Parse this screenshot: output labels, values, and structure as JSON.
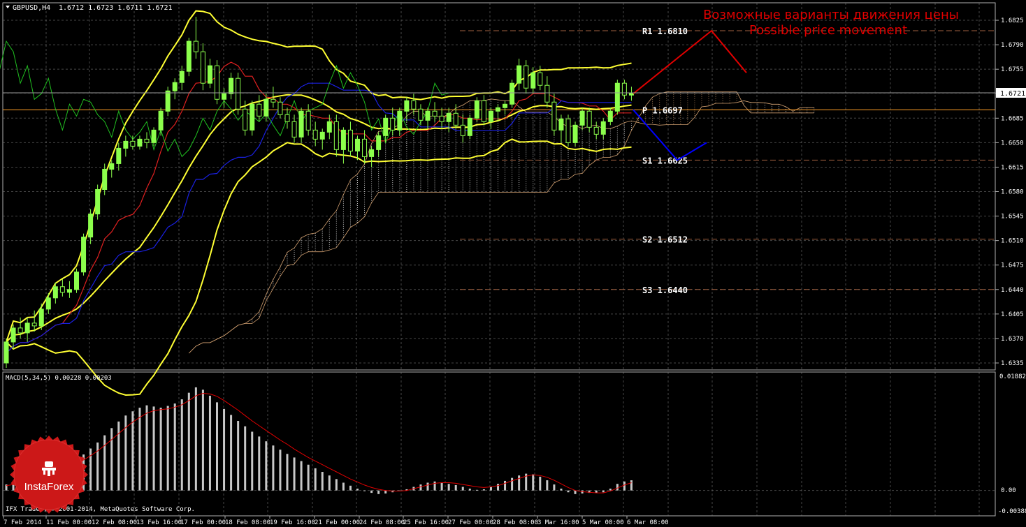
{
  "window": {
    "symbol_label": "GBPUSD,H4",
    "ohlc_label": "1.6712 1.6723 1.6711 1.6721",
    "copyright": "IFX Trader, © 2001-2014, MetaQuotes Software Corp."
  },
  "annotation": {
    "title_ru": "Возможные варианты движения цены",
    "title_en": "Possible price movement"
  },
  "levels": [
    {
      "label": "R1",
      "value": "1.6810"
    },
    {
      "label": "P",
      "value": "1.6697"
    },
    {
      "label": "S1",
      "value": "1.6625"
    },
    {
      "label": "S2",
      "value": "1.6512"
    },
    {
      "label": "S3",
      "value": "1.6440"
    }
  ],
  "current_price": "1.6721",
  "macd": {
    "label": "MACD(5,34,5) 0.00228 0.00203",
    "top_tick": "0.01882",
    "zero_tick": "0.00",
    "bottom_tick": "-0.00388"
  },
  "logo": {
    "text": "InstaForex"
  },
  "colors": {
    "background": "#000000",
    "grid": "#808080",
    "bullish": "#8cff4c",
    "bearish": "#000000",
    "bands": "#ffff33",
    "red_ma": "#e02020",
    "blue_ma": "#1a20e0",
    "chikou": "#20c020",
    "cloud": "#d2a070",
    "pivot": "#ffa028",
    "forecast_up": "#e00000",
    "forecast_down": "#0000ff",
    "macd_hist": "#c8c8c8",
    "macd_signal": "#e00000"
  },
  "chart_data": {
    "type": "candlestick",
    "symbol": "GBPUSD",
    "timeframe": "H4",
    "y_ticks": [
      "1.6825",
      "1.6790",
      "1.6755",
      "1.6721",
      "1.6685",
      "1.6650",
      "1.6615",
      "1.6580",
      "1.6545",
      "1.6510",
      "1.6475",
      "1.6440",
      "1.6405",
      "1.6370",
      "1.6335"
    ],
    "ylim": [
      1.6328,
      1.6842
    ],
    "x_ticks": [
      "7 Feb 2014",
      "11 Feb 00:00",
      "12 Feb 08:00",
      "13 Feb 16:00",
      "17 Feb 00:00",
      "18 Feb 08:00",
      "19 Feb 16:00",
      "21 Feb 00:00",
      "24 Feb 08:00",
      "25 Feb 16:00",
      "27 Feb 00:00",
      "28 Feb 08:00",
      "3 Mar 16:00",
      "5 Mar 00:00",
      "6 Mar 08:00"
    ],
    "pivot_levels": {
      "R1": 1.681,
      "P": 1.6697,
      "S1": 1.6625,
      "S2": 1.6512,
      "S3": 1.644
    },
    "candles": [
      [
        1.6335,
        1.637,
        1.6328,
        1.6365
      ],
      [
        1.6365,
        1.639,
        1.6355,
        1.6385
      ],
      [
        1.6385,
        1.64,
        1.637,
        1.6378
      ],
      [
        1.6378,
        1.64,
        1.6365,
        1.6392
      ],
      [
        1.6392,
        1.641,
        1.638,
        1.6388
      ],
      [
        1.6388,
        1.642,
        1.6382,
        1.6412
      ],
      [
        1.6412,
        1.6435,
        1.6405,
        1.6428
      ],
      [
        1.6428,
        1.645,
        1.642,
        1.6444
      ],
      [
        1.6444,
        1.6455,
        1.643,
        1.6436
      ],
      [
        1.6436,
        1.6452,
        1.6428,
        1.644
      ],
      [
        1.644,
        1.647,
        1.6435,
        1.6465
      ],
      [
        1.6465,
        1.652,
        1.646,
        1.6515
      ],
      [
        1.6515,
        1.6555,
        1.6505,
        1.6548
      ],
      [
        1.6548,
        1.659,
        1.654,
        1.6583
      ],
      [
        1.6583,
        1.662,
        1.6575,
        1.6612
      ],
      [
        1.6612,
        1.6625,
        1.66,
        1.662
      ],
      [
        1.662,
        1.665,
        1.661,
        1.6642
      ],
      [
        1.6642,
        1.666,
        1.663,
        1.6652
      ],
      [
        1.6652,
        1.666,
        1.664,
        1.6645
      ],
      [
        1.6645,
        1.666,
        1.664,
        1.6655
      ],
      [
        1.6655,
        1.6665,
        1.6642,
        1.665
      ],
      [
        1.665,
        1.6672,
        1.6645,
        1.6668
      ],
      [
        1.6668,
        1.67,
        1.666,
        1.6695
      ],
      [
        1.6695,
        1.673,
        1.6688,
        1.6724
      ],
      [
        1.6724,
        1.6742,
        1.6712,
        1.6736
      ],
      [
        1.6736,
        1.676,
        1.6725,
        1.6752
      ],
      [
        1.6752,
        1.68,
        1.6745,
        1.6795
      ],
      [
        1.6795,
        1.683,
        1.677,
        1.678
      ],
      [
        1.678,
        1.6792,
        1.6725,
        1.6735
      ],
      [
        1.6735,
        1.677,
        1.6728,
        1.676
      ],
      [
        1.676,
        1.6768,
        1.6705,
        1.6712
      ],
      [
        1.6712,
        1.6728,
        1.67,
        1.672
      ],
      [
        1.672,
        1.675,
        1.6712,
        1.6742
      ],
      [
        1.6742,
        1.675,
        1.669,
        1.6698
      ],
      [
        1.6698,
        1.671,
        1.666,
        1.6668
      ],
      [
        1.6668,
        1.671,
        1.666,
        1.6705
      ],
      [
        1.6705,
        1.6718,
        1.668,
        1.6688
      ],
      [
        1.6688,
        1.672,
        1.668,
        1.6712
      ],
      [
        1.6712,
        1.673,
        1.67,
        1.6708
      ],
      [
        1.6708,
        1.6715,
        1.6685,
        1.669
      ],
      [
        1.669,
        1.67,
        1.667,
        1.668
      ],
      [
        1.668,
        1.669,
        1.665,
        1.6658
      ],
      [
        1.6658,
        1.67,
        1.665,
        1.6695
      ],
      [
        1.6695,
        1.6705,
        1.666,
        1.6668
      ],
      [
        1.6668,
        1.668,
        1.6645,
        1.6655
      ],
      [
        1.6655,
        1.667,
        1.664,
        1.6665
      ],
      [
        1.6665,
        1.669,
        1.6655,
        1.668
      ],
      [
        1.668,
        1.669,
        1.663,
        1.664
      ],
      [
        1.664,
        1.6672,
        1.662,
        1.6668
      ],
      [
        1.6668,
        1.668,
        1.663,
        1.6638
      ],
      [
        1.6638,
        1.666,
        1.6625,
        1.6655
      ],
      [
        1.6655,
        1.6668,
        1.662,
        1.663
      ],
      [
        1.663,
        1.6645,
        1.6615,
        1.664
      ],
      [
        1.664,
        1.6665,
        1.663,
        1.666
      ],
      [
        1.666,
        1.669,
        1.665,
        1.6685
      ],
      [
        1.6685,
        1.67,
        1.666,
        1.6668
      ],
      [
        1.6668,
        1.67,
        1.666,
        1.6695
      ],
      [
        1.6695,
        1.6715,
        1.668,
        1.671
      ],
      [
        1.671,
        1.672,
        1.669,
        1.6698
      ],
      [
        1.6698,
        1.6705,
        1.6675,
        1.6682
      ],
      [
        1.6682,
        1.67,
        1.667,
        1.6695
      ],
      [
        1.6695,
        1.6708,
        1.668,
        1.6688
      ],
      [
        1.6688,
        1.67,
        1.667,
        1.668
      ],
      [
        1.668,
        1.67,
        1.6665,
        1.6692
      ],
      [
        1.6692,
        1.6705,
        1.667,
        1.6675
      ],
      [
        1.6675,
        1.669,
        1.665,
        1.666
      ],
      [
        1.666,
        1.669,
        1.6655,
        1.6685
      ],
      [
        1.6685,
        1.6715,
        1.668,
        1.671
      ],
      [
        1.671,
        1.6718,
        1.6675,
        1.668
      ],
      [
        1.668,
        1.67,
        1.667,
        1.6695
      ],
      [
        1.6695,
        1.6705,
        1.668,
        1.67
      ],
      [
        1.67,
        1.671,
        1.669,
        1.6705
      ],
      [
        1.6705,
        1.674,
        1.67,
        1.6735
      ],
      [
        1.6735,
        1.677,
        1.6725,
        1.676
      ],
      [
        1.676,
        1.6768,
        1.672,
        1.6728
      ],
      [
        1.6728,
        1.6758,
        1.672,
        1.675
      ],
      [
        1.675,
        1.676,
        1.6725,
        1.6732
      ],
      [
        1.6732,
        1.6745,
        1.67,
        1.6708
      ],
      [
        1.6708,
        1.672,
        1.666,
        1.6668
      ],
      [
        1.6668,
        1.669,
        1.665,
        1.6684
      ],
      [
        1.6684,
        1.669,
        1.6645,
        1.665
      ],
      [
        1.665,
        1.668,
        1.6645,
        1.6675
      ],
      [
        1.6675,
        1.67,
        1.6668,
        1.6695
      ],
      [
        1.6695,
        1.67,
        1.6665,
        1.6672
      ],
      [
        1.6672,
        1.668,
        1.6655,
        1.6662
      ],
      [
        1.6662,
        1.6685,
        1.6655,
        1.668
      ],
      [
        1.668,
        1.67,
        1.6675,
        1.6695
      ],
      [
        1.6695,
        1.674,
        1.669,
        1.6735
      ],
      [
        1.6735,
        1.674,
        1.6712,
        1.6718
      ],
      [
        1.6718,
        1.673,
        1.671,
        1.6721
      ]
    ],
    "forecast_up": [
      [
        0,
        1.672
      ],
      [
        1,
        1.681
      ],
      [
        2,
        1.675
      ]
    ],
    "forecast_down": [
      [
        0,
        1.6697
      ],
      [
        1,
        1.6625
      ],
      [
        2,
        1.665
      ]
    ],
    "macd_ylim": [
      -0.00388,
      0.01882
    ],
    "macd_hist": [
      0.001,
      0.0012,
      0.0015,
      0.0019,
      0.0023,
      0.0028,
      0.0033,
      0.0038,
      0.0042,
      0.0047,
      0.0053,
      0.006,
      0.007,
      0.008,
      0.0092,
      0.0104,
      0.0115,
      0.0125,
      0.0132,
      0.0138,
      0.0142,
      0.014,
      0.0138,
      0.0141,
      0.0145,
      0.0152,
      0.0163,
      0.0172,
      0.0168,
      0.0158,
      0.0147,
      0.0136,
      0.0126,
      0.0116,
      0.0107,
      0.0098,
      0.009,
      0.0082,
      0.0075,
      0.0068,
      0.0061,
      0.0055,
      0.0049,
      0.0043,
      0.0037,
      0.0031,
      0.0025,
      0.0019,
      0.0013,
      0.0008,
      0.0003,
      -0.0001,
      -0.0004,
      -0.0006,
      -0.0005,
      -0.0003,
      -0.0001,
      0.0002,
      0.0006,
      0.001,
      0.0013,
      0.0015,
      0.0013,
      0.0011,
      0.0009,
      0.0006,
      0.0003,
      0.0001,
      0.0002,
      0.0006,
      0.0011,
      0.0016,
      0.0021,
      0.0025,
      0.0028,
      0.0027,
      0.0023,
      0.0017,
      0.001,
      0.0003,
      -0.0003,
      -0.0006,
      -0.0005,
      -0.0004,
      -0.0004,
      -0.0003,
      0.0003,
      0.0011,
      0.0015,
      0.0017
    ],
    "macd_signal": [
      0.0008,
      0.001,
      0.0012,
      0.0015,
      0.0018,
      0.0022,
      0.0026,
      0.0031,
      0.0035,
      0.004,
      0.0045,
      0.0051,
      0.0058,
      0.0066,
      0.0075,
      0.0085,
      0.0095,
      0.0105,
      0.0114,
      0.0122,
      0.0129,
      0.0133,
      0.0135,
      0.0136,
      0.0139,
      0.0143,
      0.015,
      0.0158,
      0.0162,
      0.0161,
      0.0157,
      0.015,
      0.0142,
      0.0134,
      0.0125,
      0.0116,
      0.0108,
      0.01,
      0.0092,
      0.0084,
      0.0077,
      0.0069,
      0.0062,
      0.0055,
      0.0049,
      0.0043,
      0.0037,
      0.0031,
      0.0025,
      0.0019,
      0.0014,
      0.0009,
      0.0005,
      0.0002,
      0.0,
      -0.0001,
      -0.0001,
      0.0,
      0.0003,
      0.0006,
      0.0009,
      0.0012,
      0.0013,
      0.0013,
      0.0012,
      0.001,
      0.0008,
      0.0006,
      0.0005,
      0.0006,
      0.0008,
      0.0012,
      0.0016,
      0.002,
      0.0024,
      0.0026,
      0.0025,
      0.0022,
      0.0017,
      0.0011,
      0.0005,
      0.0,
      -0.0002,
      -0.0003,
      -0.0004,
      -0.0004,
      -0.0001,
      0.0004,
      0.0009,
      0.0013
    ]
  }
}
